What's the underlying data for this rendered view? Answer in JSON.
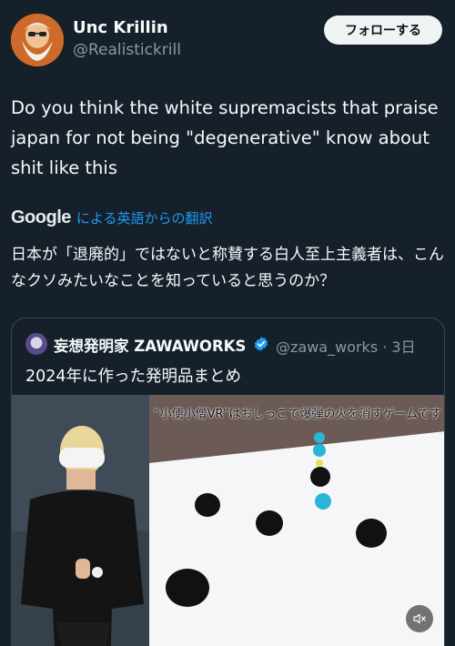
{
  "author": {
    "display_name": "Unc Krillin",
    "handle": "@Realistickrill",
    "avatar_icon": "avatar-icon"
  },
  "follow_button": {
    "label": "フォローする"
  },
  "tweet": {
    "text": "Do you think the white supremacists that praise japan for not being \"degenerative\" know about shit like this"
  },
  "translation": {
    "provider": "Google",
    "link_text": "による英語からの翻訳",
    "text": "日本が「退廃的」ではないと称賛する白人至上主義者は、こんなクソみたいなことを知っていると思うのか？"
  },
  "quote": {
    "name": "妄想発明家 ZAWAWORKS",
    "handle_time": "@zawa_works · 3日",
    "text": "2024年に作った発明品まとめ",
    "media_caption": "“小便小僧VR”はおしっこで爆弾の火を消すゲームです",
    "verified_icon": "verified-badge-icon",
    "mute_icon": "mute-icon"
  },
  "colors": {
    "background": "#15202b",
    "link": "#1d9bf0",
    "secondary_text": "#8b98a5",
    "border": "#38444d"
  }
}
